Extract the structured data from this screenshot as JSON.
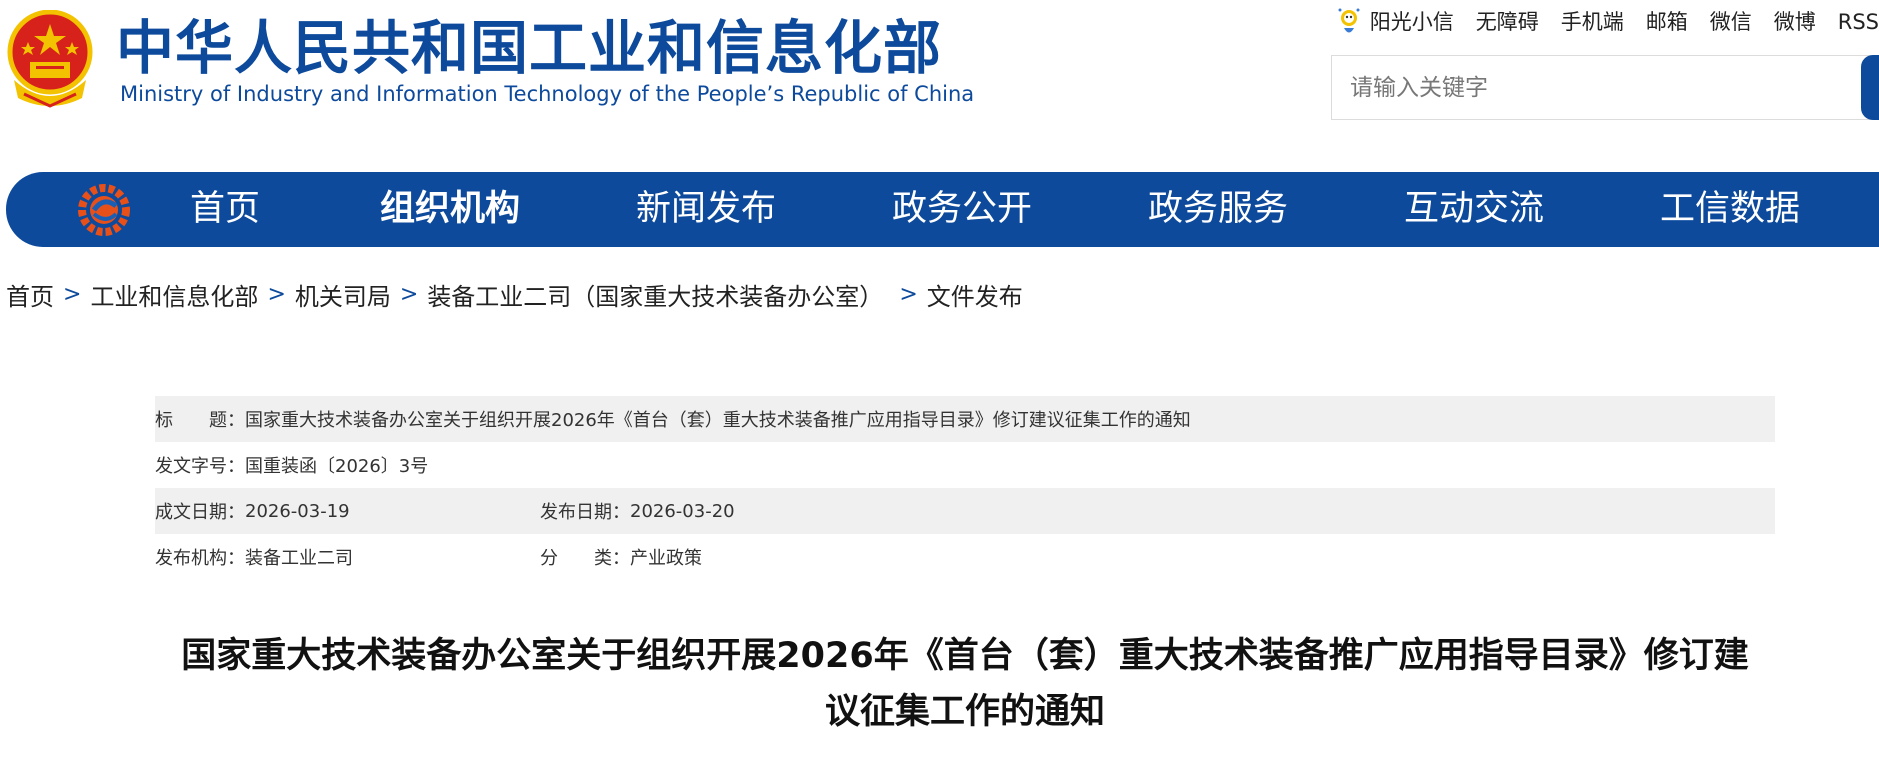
{
  "header": {
    "title_cn": "中华人民共和国工业和信息化部",
    "title_en": "Ministry of Industry and Information Technology of the People’s Republic of China",
    "emblem_icon": "national-emblem-icon",
    "links": [
      "阳光小信",
      "无障碍",
      "手机端",
      "邮箱",
      "微信",
      "微博",
      "RSS"
    ],
    "search_placeholder": "请输入关键字"
  },
  "nav": {
    "logo_icon": "miit-logo-icon",
    "items": [
      "首页",
      "组织机构",
      "新闻发布",
      "政务公开",
      "政务服务",
      "互动交流",
      "工信数据"
    ],
    "active_index": 1
  },
  "breadcrumb": {
    "items": [
      "首页",
      "工业和信息化部",
      "机关司局",
      "装备工业二司（国家重大技术装备办公室）",
      "文件发布"
    ],
    "separator": ">"
  },
  "meta": {
    "title_label": "标　　题：",
    "title_value": "国家重大技术装备办公室关于组织开展2026年《首台（套）重大技术装备推广应用指导目录》修订建议征集工作的通知",
    "docno_label": "发文字号：",
    "docno_value": "国重装函〔2026〕3号",
    "created_label": "成文日期：",
    "created_value": "2026-03-19",
    "published_label": "发布日期：",
    "published_value": "2026-03-20",
    "org_label": "发布机构：",
    "org_value": "装备工业二司",
    "category_label": "分　　类：",
    "category_value": "产业政策"
  },
  "article": {
    "title_line1": "国家重大技术装备办公室关于组织开展2026年《首台（套）重大技术装备推广应用指导目录》修订建",
    "title_line2": "议征集工作的通知"
  },
  "colors": {
    "brand_blue": "#0d4a9c",
    "emblem_red": "#d7221c",
    "emblem_gold": "#f3c200"
  }
}
